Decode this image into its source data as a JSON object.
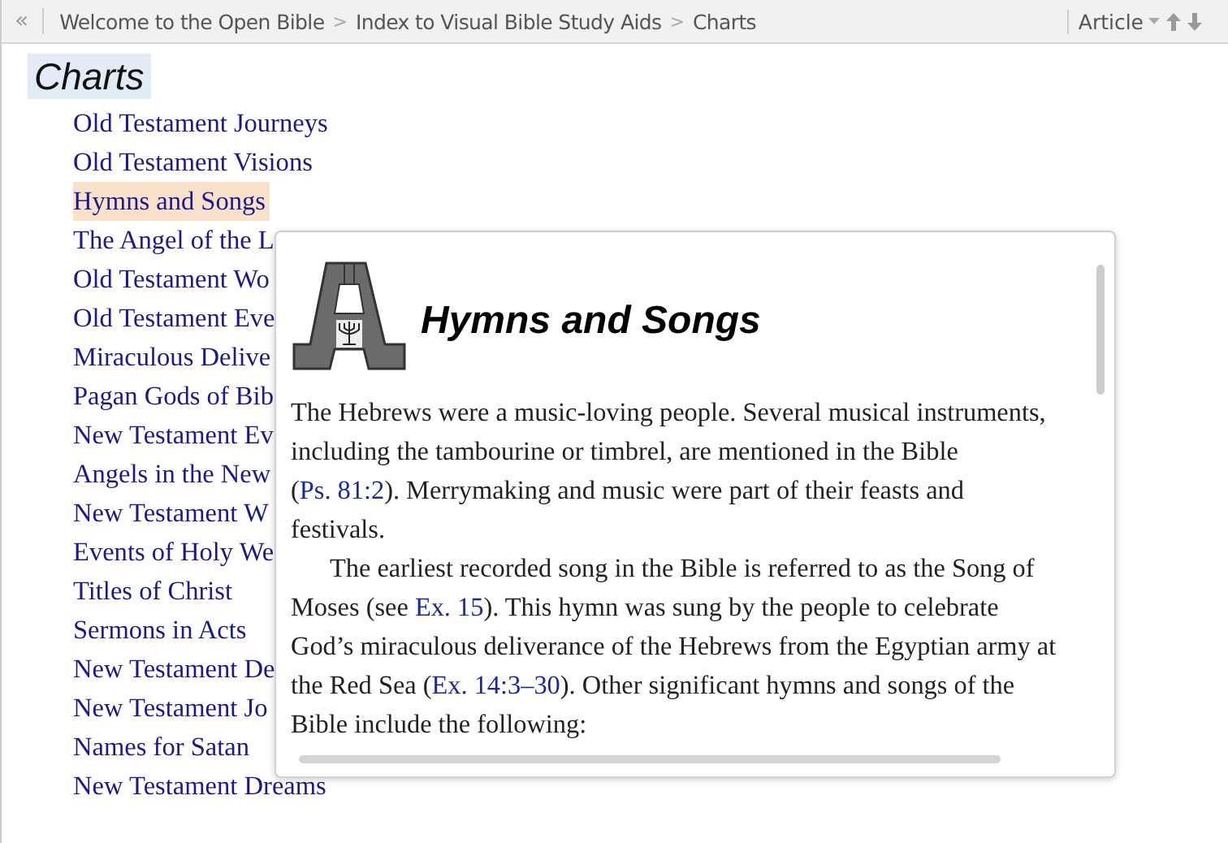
{
  "toolbar": {
    "back": "«",
    "breadcrumbs": [
      {
        "label": "Welcome to the Open Bible"
      },
      {
        "label": "Index to Visual Bible Study Aids"
      },
      {
        "label": "Charts"
      }
    ],
    "separator": ">",
    "view": "Article"
  },
  "heading": "Charts",
  "items": [
    {
      "label": "Old Testament Journeys",
      "selected": false
    },
    {
      "label": "Old Testament Visions",
      "selected": false
    },
    {
      "label": "Hymns and Songs",
      "selected": true
    },
    {
      "label": "The Angel of the L",
      "selected": false
    },
    {
      "label": "Old Testament Wo",
      "selected": false
    },
    {
      "label": "Old Testament Eve",
      "selected": false
    },
    {
      "label": "Miraculous Delive",
      "selected": false
    },
    {
      "label": "Pagan Gods of Bib",
      "selected": false
    },
    {
      "label": "New Testament Ev",
      "selected": false
    },
    {
      "label": "Angels in the New",
      "selected": false
    },
    {
      "label": "New Testament W",
      "selected": false
    },
    {
      "label": "Events of Holy We",
      "selected": false
    },
    {
      "label": "Titles of Christ",
      "selected": false
    },
    {
      "label": "Sermons in Acts",
      "selected": false
    },
    {
      "label": "New Testament De",
      "selected": false
    },
    {
      "label": "New Testament Jo",
      "selected": false
    },
    {
      "label": "Names for Satan",
      "selected": false
    },
    {
      "label": "New Testament Dreams",
      "selected": false
    }
  ],
  "popup": {
    "title": "Hymns and Songs",
    "paragraphs": [
      {
        "indent": false,
        "parts": [
          {
            "kind": "text",
            "text": "The Hebrews were a music-loving people. Several musical instruments, including the tambourine or timbrel, are mentioned in the Bible ("
          },
          {
            "kind": "link",
            "text": "Ps. 81:2"
          },
          {
            "kind": "text",
            "text": "). Merrymaking and music were part of their feasts and festivals."
          }
        ]
      },
      {
        "indent": true,
        "parts": [
          {
            "kind": "text",
            "text": "The earliest recorded song in the Bible is referred to as the Song of Moses (see "
          },
          {
            "kind": "link",
            "text": "Ex. 15"
          },
          {
            "kind": "text",
            "text": "). This hymn was sung by the people to celebrate God’s miraculous deliverance of the Hebrews from the Egyptian army at the Red Sea ("
          },
          {
            "kind": "link",
            "text": "Ex. 14:3–30"
          },
          {
            "kind": "text",
            "text": "). Other significant hymns and songs of the Bible include the following:"
          }
        ]
      }
    ]
  }
}
